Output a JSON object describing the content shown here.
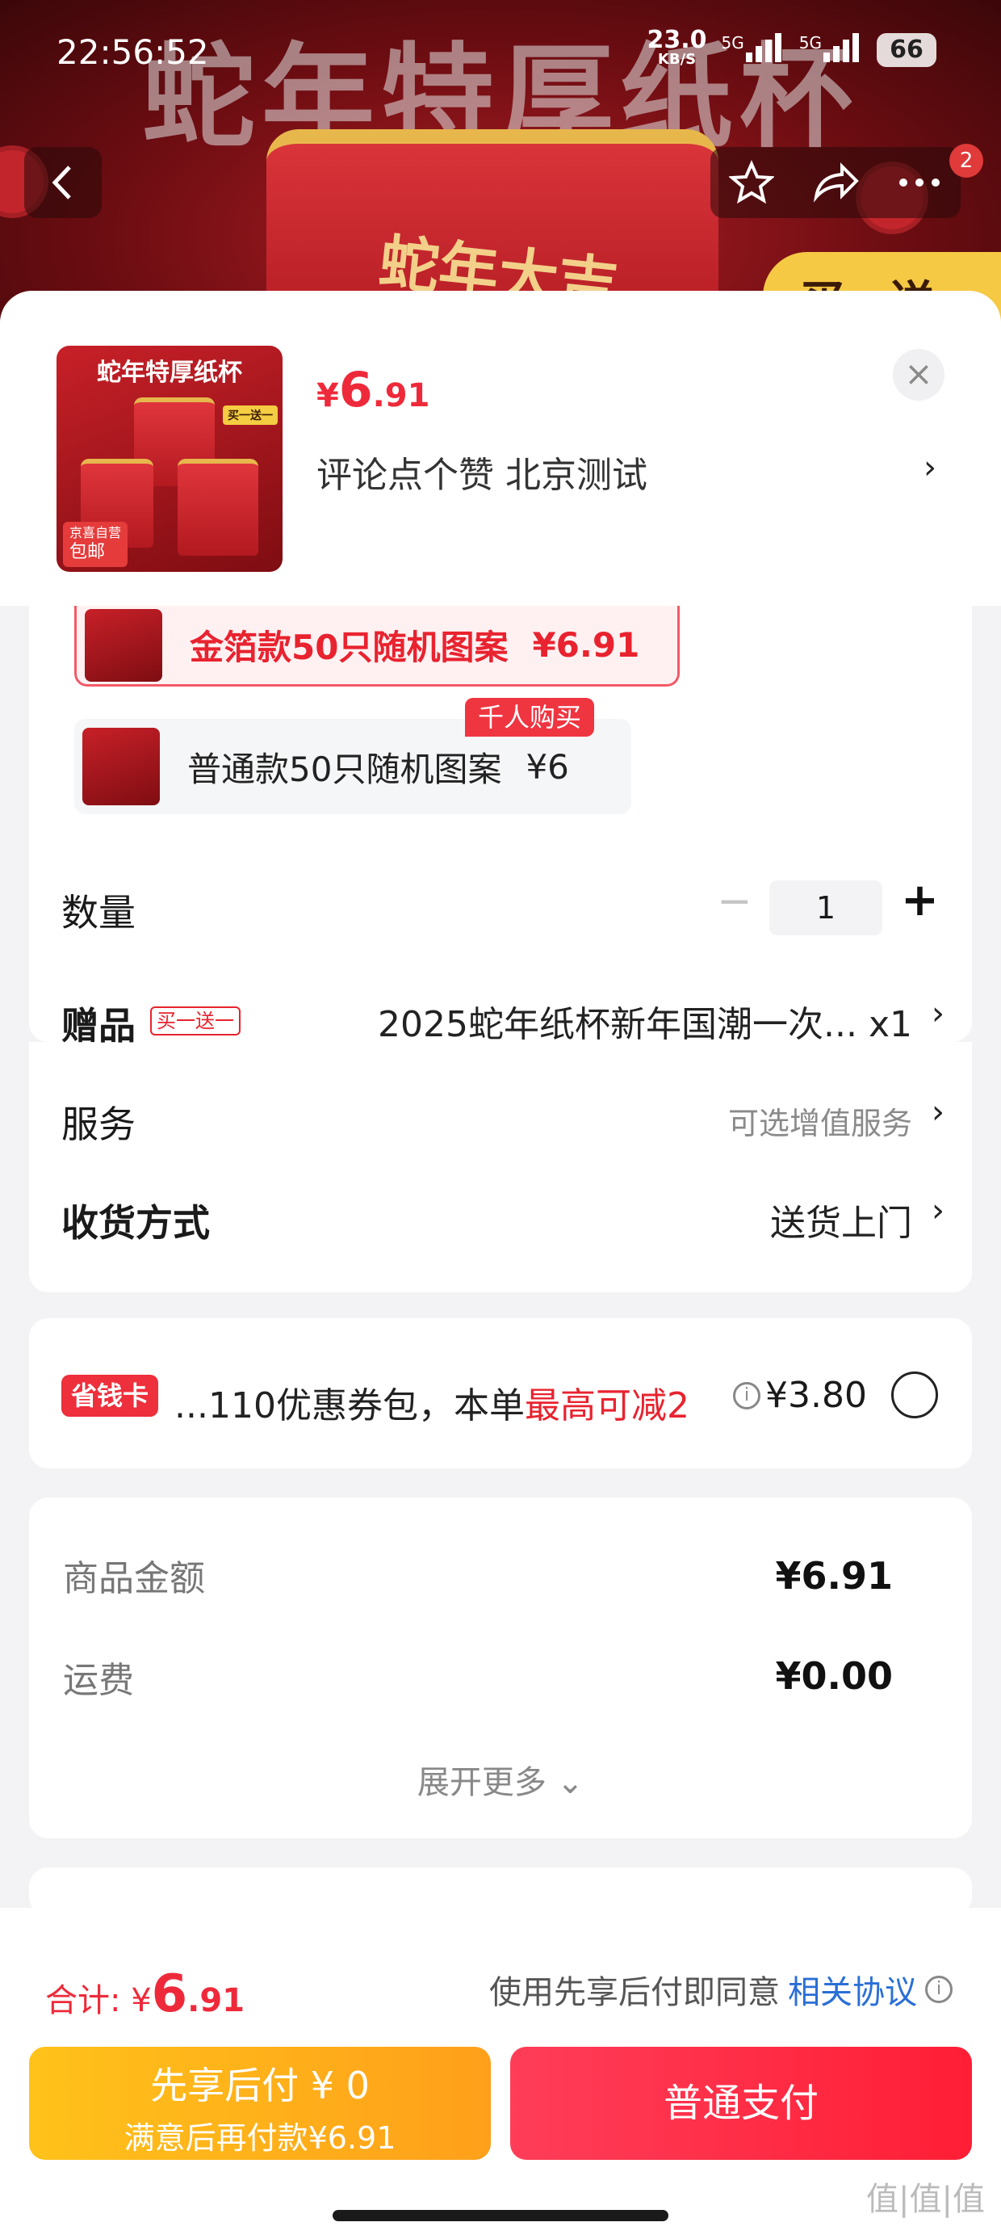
{
  "status_bar": {
    "time": "22:56:52",
    "net_speed": "23.0",
    "net_unit": "KB/S",
    "signal1": "5G",
    "signal2": "5G",
    "battery": "66"
  },
  "banner": {
    "title": "蛇年特厚纸杯",
    "cup_text": "蛇年大吉",
    "badge": "买一送"
  },
  "top_nav": {
    "cart_badge": "2"
  },
  "product": {
    "thumb_title": "蛇年特厚纸杯",
    "thumb_tag1": "京喜自营",
    "thumb_tag2": "包邮",
    "thumb_badge": "买一送一",
    "price_symbol": "¥",
    "price_int": "6",
    "price_dec": ".91",
    "selection": "评论点个赞  北京测试",
    "close": "×"
  },
  "options": [
    {
      "label": "金箔款50只随机图案",
      "price": "¥6.91"
    },
    {
      "label": "普通款50只随机图案",
      "price": "¥6",
      "tag": "千人购买"
    }
  ],
  "quantity": {
    "label": "数量",
    "value": "1",
    "minus": "−",
    "plus": "+"
  },
  "gift": {
    "label": "赠品",
    "tag": "买一送一",
    "value": "2025蛇年纸杯新年国潮一次... x1"
  },
  "service": {
    "label": "服务",
    "value": "可选增值服务"
  },
  "delivery": {
    "label": "收货方式",
    "value": "送货上门"
  },
  "coupon": {
    "badge": "省钱卡",
    "text": "...110优惠券包，本单",
    "highlight": "最高可减2",
    "amount": "¥3.80"
  },
  "summary": {
    "goods_label": "商品金额",
    "goods_value": "¥6.91",
    "shipping_label": "运费",
    "shipping_value": "¥0.00",
    "expand": "展开更多"
  },
  "footer": {
    "total_label": "合计: ¥",
    "total_int": "6",
    "total_dec": ".91",
    "agree_text": "使用先享后付即同意",
    "agree_link": "相关协议",
    "paylater_line1": "先享后付 ¥ 0",
    "paylater_line2": "满意后再付款¥6.91",
    "pay_label": "普通支付"
  },
  "watermark": "值|值|值"
}
